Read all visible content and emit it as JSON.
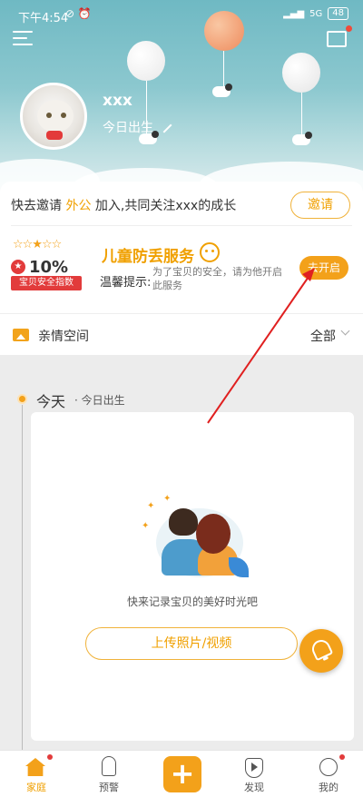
{
  "status_bar": {
    "time": "下午4:54",
    "battery": "48",
    "network": "5G"
  },
  "profile": {
    "name": "xxx",
    "birth": "今日出生"
  },
  "invite": {
    "text_prefix": "快去邀请 ",
    "highlight": "外公",
    "text_suffix": " 加入,共同关注xxx的成长",
    "button": "邀请"
  },
  "safety": {
    "percent": "10%",
    "badge_label": "宝贝安全指数",
    "title": "儿童防丢服务",
    "tip_label": "温馨提示:",
    "tip_text": "为了宝贝的安全，请为他开启此服务",
    "open_button": "去开启"
  },
  "family": {
    "label": "亲情空间",
    "filter": "全部"
  },
  "timeline": {
    "today": "今天",
    "today_sub": "· 今日出生",
    "empty_text": "快来记录宝贝的美好时光吧",
    "upload_button": "上传照片/视频"
  },
  "tabs": [
    {
      "label": "家庭",
      "icon": "home-icon"
    },
    {
      "label": "预警",
      "icon": "alert-icon"
    },
    {
      "label": "",
      "icon": "plus-icon"
    },
    {
      "label": "发现",
      "icon": "play-icon"
    },
    {
      "label": "我的",
      "icon": "profile-icon"
    }
  ],
  "colors": {
    "accent": "#f3a11a",
    "red": "#e23b3b",
    "annotation_arrow": "#e02020"
  }
}
